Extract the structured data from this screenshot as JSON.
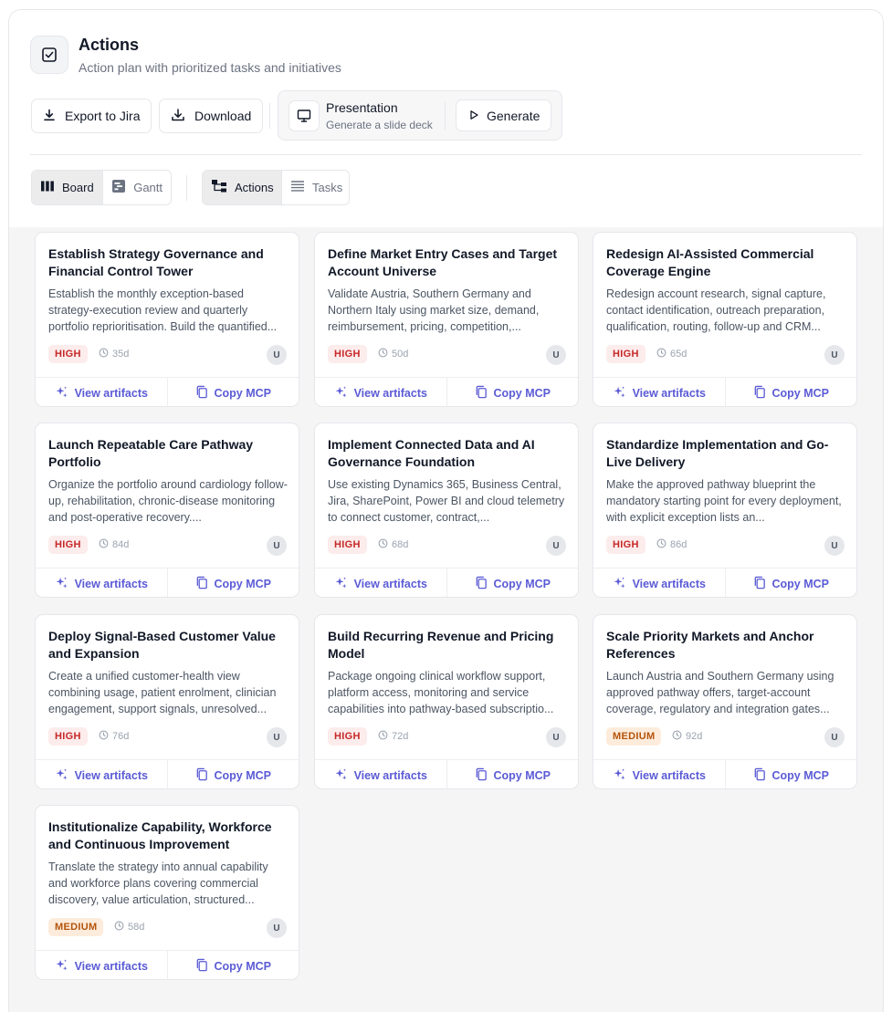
{
  "header": {
    "title": "Actions",
    "subtitle": "Action plan with prioritized tasks and initiatives"
  },
  "toolbar": {
    "export_label": "Export to Jira",
    "download_label": "Download",
    "presentation_title": "Presentation",
    "presentation_subtitle": "Generate a slide deck",
    "generate_label": "Generate"
  },
  "view_toggle": {
    "board_label": "Board",
    "gantt_label": "Gantt",
    "active": "Board"
  },
  "mode_toggle": {
    "actions_label": "Actions",
    "tasks_label": "Tasks",
    "active": "Actions"
  },
  "card_actions": {
    "view_artifacts": "View artifacts",
    "copy_mcp": "Copy MCP"
  },
  "cards": [
    {
      "title": "Establish Strategy Governance and Financial Control Tower",
      "description": "Establish the monthly exception-based strategy-execution review and quarterly portfolio reprioritisation. Build the quantified...",
      "priority": "HIGH",
      "duration": "35d",
      "owner": "U"
    },
    {
      "title": "Define Market Entry Cases and Target Account Universe",
      "description": "Validate Austria, Southern Germany and Northern Italy using market size, demand, reimbursement, pricing, competition,...",
      "priority": "HIGH",
      "duration": "50d",
      "owner": "U"
    },
    {
      "title": "Redesign AI-Assisted Commercial Coverage Engine",
      "description": "Redesign account research, signal capture, contact identification, outreach preparation, qualification, routing, follow-up and CRM...",
      "priority": "HIGH",
      "duration": "65d",
      "owner": "U"
    },
    {
      "title": "Launch Repeatable Care Pathway Portfolio",
      "description": "Organize the portfolio around cardiology follow-up, rehabilitation, chronic-disease monitoring and post-operative recovery....",
      "priority": "HIGH",
      "duration": "84d",
      "owner": "U"
    },
    {
      "title": "Implement Connected Data and AI Governance Foundation",
      "description": "Use existing Dynamics 365, Business Central, Jira, SharePoint, Power BI and cloud telemetry to connect customer, contract,...",
      "priority": "HIGH",
      "duration": "68d",
      "owner": "U"
    },
    {
      "title": "Standardize Implementation and Go-Live Delivery",
      "description": "Make the approved pathway blueprint the mandatory starting point for every deployment, with explicit exception lists an...",
      "priority": "HIGH",
      "duration": "86d",
      "owner": "U"
    },
    {
      "title": "Deploy Signal-Based Customer Value and Expansion",
      "description": "Create a unified customer-health view combining usage, patient enrolment, clinician engagement, support signals, unresolved...",
      "priority": "HIGH",
      "duration": "76d",
      "owner": "U"
    },
    {
      "title": "Build Recurring Revenue and Pricing Model",
      "description": "Package ongoing clinical workflow support, platform access, monitoring and service capabilities into pathway-based subscriptio...",
      "priority": "HIGH",
      "duration": "72d",
      "owner": "U"
    },
    {
      "title": "Scale Priority Markets and Anchor References",
      "description": "Launch Austria and Southern Germany using approved pathway offers, target-account coverage, regulatory and integration gates...",
      "priority": "MEDIUM",
      "duration": "92d",
      "owner": "U"
    },
    {
      "title": "Institutionalize Capability, Workforce and Continuous Improvement",
      "description": "Translate the strategy into annual capability and workforce plans covering commercial discovery, value articulation, structured...",
      "priority": "MEDIUM",
      "duration": "58d",
      "owner": "U"
    }
  ],
  "colors": {
    "accent": "#5b5bd6",
    "high_badge_text": "#c62828",
    "high_badge_bg": "#fdecec",
    "medium_badge_text": "#b45309",
    "medium_badge_bg": "#fdecdc"
  }
}
